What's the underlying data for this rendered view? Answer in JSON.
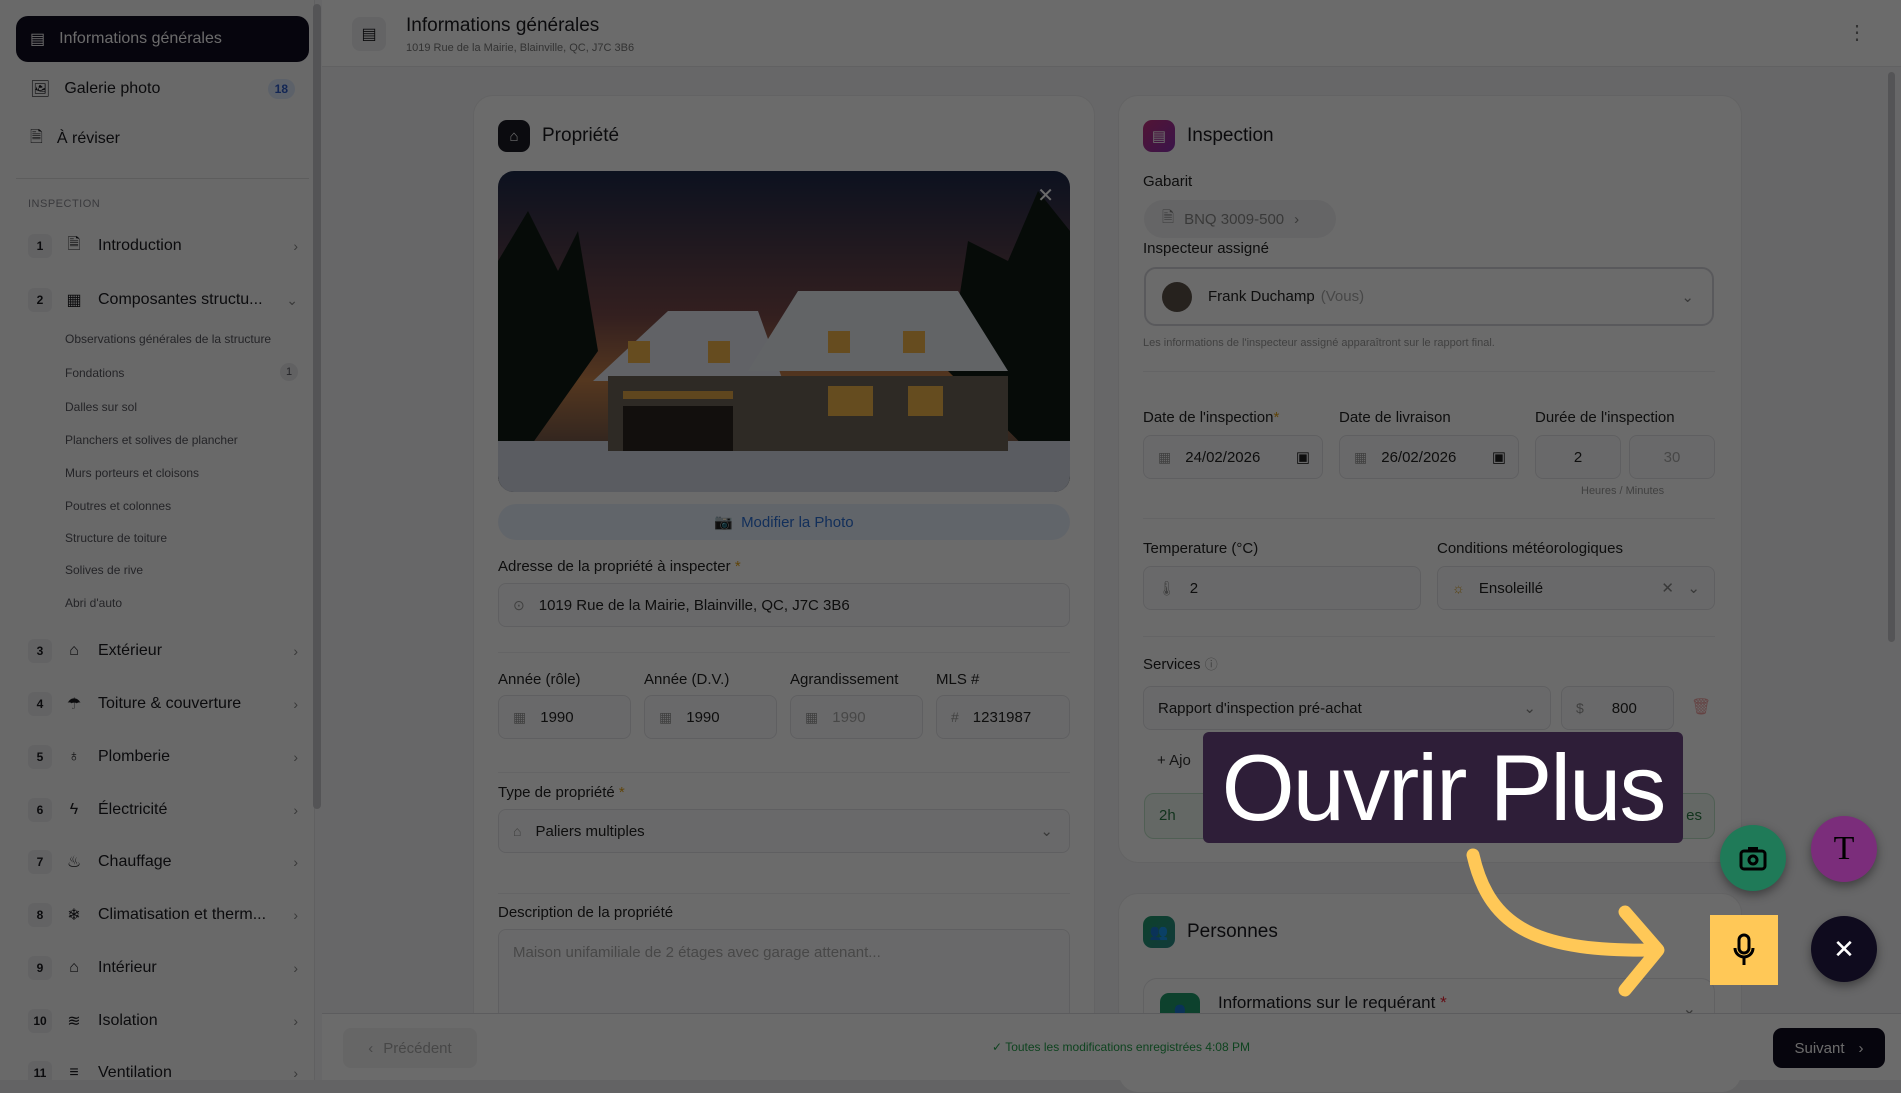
{
  "sidebar": {
    "top": [
      {
        "label": "Informations générales"
      },
      {
        "label": "Galerie photo",
        "badge": "18"
      },
      {
        "label": "À réviser"
      }
    ],
    "section": "INSPECTION",
    "steps": [
      {
        "num": "1",
        "label": "Introduction"
      },
      {
        "num": "2",
        "label": "Composantes structu..."
      },
      {
        "num": "3",
        "label": "Extérieur"
      },
      {
        "num": "4",
        "label": "Toiture & couverture"
      },
      {
        "num": "5",
        "label": "Plomberie"
      },
      {
        "num": "6",
        "label": "Électricité"
      },
      {
        "num": "7",
        "label": "Chauffage"
      },
      {
        "num": "8",
        "label": "Climatisation et therm..."
      },
      {
        "num": "9",
        "label": "Intérieur"
      },
      {
        "num": "10",
        "label": "Isolation"
      },
      {
        "num": "11",
        "label": "Ventilation"
      }
    ],
    "subitems": [
      {
        "label": "Observations générales de la structure"
      },
      {
        "label": "Fondations",
        "count": "1"
      },
      {
        "label": "Dalles sur sol"
      },
      {
        "label": "Planchers et solives de plancher"
      },
      {
        "label": "Murs porteurs et cloisons"
      },
      {
        "label": "Poutres et colonnes"
      },
      {
        "label": "Structure de toiture"
      },
      {
        "label": "Solives de rive"
      },
      {
        "label": "Abri d'auto"
      }
    ]
  },
  "header": {
    "title": "Informations générales",
    "subtitle": "1019 Rue de la Mairie, Blainville, QC, J7C 3B6"
  },
  "property": {
    "title": "Propriété",
    "modify_photo": "Modifier la Photo",
    "address_label": "Adresse de la propriété à inspecter",
    "address": "1019 Rue de la Mairie, Blainville, QC, J7C 3B6",
    "year_role_label": "Année (rôle)",
    "year_role": "1990",
    "year_dv_label": "Année (D.V.)",
    "year_dv": "1990",
    "extension_label": "Agrandissement",
    "extension_placeholder": "1990",
    "mls_label": "MLS #",
    "mls": "1231987",
    "type_label": "Type de propriété",
    "type": "Paliers multiples",
    "desc_label": "Description de la propriété",
    "desc_placeholder": "Maison unifamiliale de 2 étages avec garage attenant..."
  },
  "inspection": {
    "title": "Inspection",
    "template_label": "Gabarit",
    "template": "BNQ 3009-500",
    "inspector_label": "Inspecteur assigné",
    "inspector": "Frank Duchamp",
    "inspector_you": "(Vous)",
    "inspector_hint": "Les informations de l'inspecteur assigné apparaîtront sur le rapport final.",
    "date_label": "Date de l'inspection",
    "date": "24/02/2026",
    "delivery_label": "Date de livraison",
    "delivery": "26/02/2026",
    "duration_label": "Durée de l'inspection",
    "hours": "2",
    "minutes_placeholder": "30",
    "duration_hint": "Heures / Minutes",
    "temp_label": "Temperature (°C)",
    "temp": "2",
    "weather_label": "Conditions météorologiques",
    "weather": "Ensoleillé",
    "services_label": "Services",
    "service": "Rapport d'inspection pré-achat",
    "currency": "$",
    "price": "800",
    "add_label": "Ajo",
    "summary_hours": "2h",
    "summary_tail": "es"
  },
  "people": {
    "title": "Personnes",
    "requester": "Informations sur le requérant"
  },
  "footer": {
    "prev": "Précédent",
    "status": "Toutes les modifications enregistrées 4:08 PM",
    "next": "Suivant"
  },
  "overlay": {
    "tooltip": "Ouvrir Plus"
  },
  "colors": {
    "accent_yellow": "#ffc857",
    "camera": "#1f7a58",
    "text": "#7b2d7b",
    "dark": "#0f0b1e"
  }
}
